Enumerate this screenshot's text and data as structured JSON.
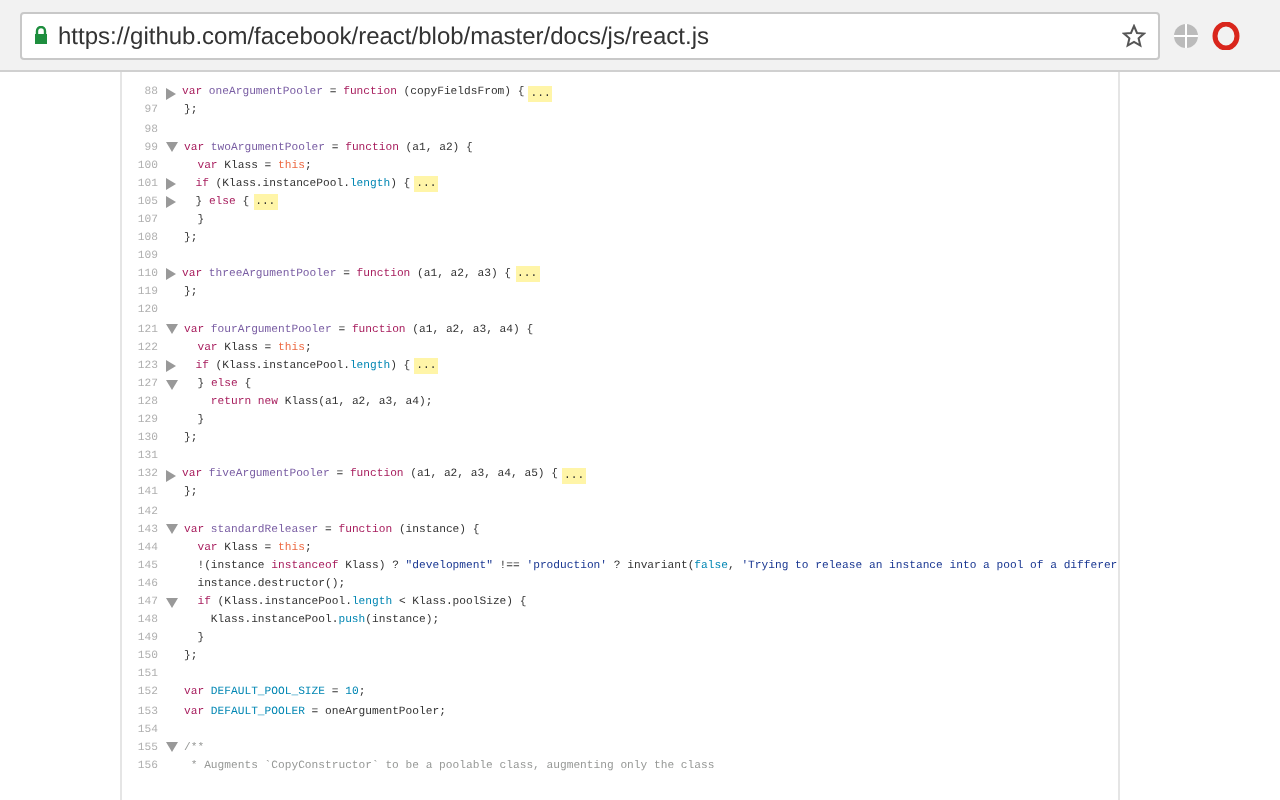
{
  "address_bar": {
    "url": "https://github.com/facebook/react/blob/master/docs/js/react.js"
  },
  "code_lines": [
    {
      "number": "88",
      "kind": "collapsed",
      "tokens": [
        {
          "kind": "kw",
          "text": "var"
        },
        {
          "kind": "name",
          "text": " oneArgumentPooler"
        },
        {
          "kind": "plain",
          "text": " = "
        },
        {
          "kind": "kw",
          "text": "function"
        },
        {
          "kind": "plain",
          "text": " (copyFieldsFrom) {"
        }
      ],
      "collapsed_marker": "..."
    },
    {
      "number": "97",
      "kind": "plain",
      "tokens": [
        {
          "kind": "plain",
          "text": "};"
        }
      ]
    },
    {
      "number": "98",
      "kind": "plain"
    },
    {
      "number": "99",
      "kind": "expanded",
      "tokens": [
        {
          "kind": "kw",
          "text": "var"
        },
        {
          "kind": "name",
          "text": " twoArgumentPooler"
        },
        {
          "kind": "plain",
          "text": " = "
        },
        {
          "kind": "kw",
          "text": "function"
        },
        {
          "kind": "plain",
          "text": " (a1, a2) {"
        }
      ]
    },
    {
      "number": "100",
      "kind": "plain",
      "tokens": [
        {
          "kind": "kw",
          "text": "  var"
        },
        {
          "kind": "plain",
          "text": " Klass = "
        },
        {
          "kind": "self",
          "text": "this"
        },
        {
          "kind": "plain",
          "text": ";"
        }
      ]
    },
    {
      "number": "101",
      "kind": "collapsed",
      "tokens": [
        {
          "kind": "kw",
          "text": "  if"
        },
        {
          "kind": "plain",
          "text": " (Klass.instancePool."
        },
        {
          "kind": "builtin",
          "text": "length"
        },
        {
          "kind": "plain",
          "text": ") {"
        }
      ],
      "collapsed_marker": "..."
    },
    {
      "number": "105",
      "kind": "collapsed",
      "tokens": [
        {
          "kind": "plain",
          "text": "  } "
        },
        {
          "kind": "kw",
          "text": "else"
        },
        {
          "kind": "plain",
          "text": " {"
        }
      ],
      "collapsed_marker": "..."
    },
    {
      "number": "107",
      "kind": "plain",
      "tokens": [
        {
          "kind": "plain",
          "text": "  }"
        }
      ]
    },
    {
      "number": "108",
      "kind": "plain",
      "tokens": [
        {
          "kind": "plain",
          "text": "};"
        }
      ]
    },
    {
      "number": "109",
      "kind": "plain"
    },
    {
      "number": "110",
      "kind": "collapsed",
      "tokens": [
        {
          "kind": "kw",
          "text": "var"
        },
        {
          "kind": "name",
          "text": " threeArgumentPooler"
        },
        {
          "kind": "plain",
          "text": " = "
        },
        {
          "kind": "kw",
          "text": "function"
        },
        {
          "kind": "plain",
          "text": " (a1, a2, a3) {"
        }
      ],
      "collapsed_marker": "..."
    },
    {
      "number": "119",
      "kind": "plain",
      "tokens": [
        {
          "kind": "plain",
          "text": "};"
        }
      ]
    },
    {
      "number": "120",
      "kind": "plain"
    },
    {
      "number": "121",
      "kind": "expanded",
      "tokens": [
        {
          "kind": "kw",
          "text": "var"
        },
        {
          "kind": "name",
          "text": " fourArgumentPooler"
        },
        {
          "kind": "plain",
          "text": " = "
        },
        {
          "kind": "kw",
          "text": "function"
        },
        {
          "kind": "plain",
          "text": " (a1, a2, a3, a4) {"
        }
      ]
    },
    {
      "number": "122",
      "kind": "plain",
      "tokens": [
        {
          "kind": "kw",
          "text": "  var"
        },
        {
          "kind": "plain",
          "text": " Klass = "
        },
        {
          "kind": "self",
          "text": "this"
        },
        {
          "kind": "plain",
          "text": ";"
        }
      ]
    },
    {
      "number": "123",
      "kind": "collapsed",
      "tokens": [
        {
          "kind": "kw",
          "text": "  if"
        },
        {
          "kind": "plain",
          "text": " (Klass.instancePool."
        },
        {
          "kind": "builtin",
          "text": "length"
        },
        {
          "kind": "plain",
          "text": ") {"
        }
      ],
      "collapsed_marker": "..."
    },
    {
      "number": "127",
      "kind": "expanded",
      "tokens": [
        {
          "kind": "plain",
          "text": "  } "
        },
        {
          "kind": "kw",
          "text": "else"
        },
        {
          "kind": "plain",
          "text": " {"
        }
      ]
    },
    {
      "number": "128",
      "kind": "plain",
      "tokens": [
        {
          "kind": "kw",
          "text": "    return"
        },
        {
          "kind": "kw",
          "text": " new"
        },
        {
          "kind": "plain",
          "text": " Klass(a1, a2, a3, a4);"
        }
      ]
    },
    {
      "number": "129",
      "kind": "plain",
      "tokens": [
        {
          "kind": "plain",
          "text": "  }"
        }
      ]
    },
    {
      "number": "130",
      "kind": "plain",
      "tokens": [
        {
          "kind": "plain",
          "text": "};"
        }
      ]
    },
    {
      "number": "131",
      "kind": "plain"
    },
    {
      "number": "132",
      "kind": "collapsed",
      "tokens": [
        {
          "kind": "kw",
          "text": "var"
        },
        {
          "kind": "name",
          "text": " fiveArgumentPooler"
        },
        {
          "kind": "plain",
          "text": " = "
        },
        {
          "kind": "kw",
          "text": "function"
        },
        {
          "kind": "plain",
          "text": " (a1, a2, a3, a4, a5) {"
        }
      ],
      "collapsed_marker": "..."
    },
    {
      "number": "141",
      "kind": "plain",
      "tokens": [
        {
          "kind": "plain",
          "text": "};"
        }
      ]
    },
    {
      "number": "142",
      "kind": "plain"
    },
    {
      "number": "143",
      "kind": "expanded",
      "tokens": [
        {
          "kind": "kw",
          "text": "var"
        },
        {
          "kind": "name",
          "text": " standardReleaser"
        },
        {
          "kind": "plain",
          "text": " = "
        },
        {
          "kind": "kw",
          "text": "function"
        },
        {
          "kind": "plain",
          "text": " (instance) {"
        }
      ]
    },
    {
      "number": "144",
      "kind": "plain",
      "tokens": [
        {
          "kind": "kw",
          "text": "  var"
        },
        {
          "kind": "plain",
          "text": " Klass = "
        },
        {
          "kind": "self",
          "text": "this"
        },
        {
          "kind": "plain",
          "text": ";"
        }
      ]
    },
    {
      "number": "145",
      "kind": "plain",
      "tokens": [
        {
          "kind": "plain",
          "text": "  !(instance "
        },
        {
          "kind": "kw",
          "text": "instanceof"
        },
        {
          "kind": "plain",
          "text": " Klass) ? "
        },
        {
          "kind": "str",
          "text": "\"development\""
        },
        {
          "kind": "plain",
          "text": " !== "
        },
        {
          "kind": "str",
          "text": "'production'"
        },
        {
          "kind": "plain",
          "text": " ? invariant("
        },
        {
          "kind": "builtin",
          "text": "false"
        },
        {
          "kind": "plain",
          "text": ", "
        },
        {
          "kind": "str",
          "text": "'Trying to release an instance into a pool of a differer"
        }
      ]
    },
    {
      "number": "146",
      "kind": "plain",
      "tokens": [
        {
          "kind": "plain",
          "text": "  instance.destructor();"
        }
      ]
    },
    {
      "number": "147",
      "kind": "expanded",
      "tokens": [
        {
          "kind": "kw",
          "text": "  if"
        },
        {
          "kind": "plain",
          "text": " (Klass.instancePool."
        },
        {
          "kind": "builtin",
          "text": "length"
        },
        {
          "kind": "plain",
          "text": " < Klass.poolSize) {"
        }
      ]
    },
    {
      "number": "148",
      "kind": "plain",
      "tokens": [
        {
          "kind": "plain",
          "text": "    Klass.instancePool."
        },
        {
          "kind": "builtin",
          "text": "push"
        },
        {
          "kind": "plain",
          "text": "(instance);"
        }
      ]
    },
    {
      "number": "149",
      "kind": "plain",
      "tokens": [
        {
          "kind": "plain",
          "text": "  }"
        }
      ]
    },
    {
      "number": "150",
      "kind": "plain",
      "tokens": [
        {
          "kind": "plain",
          "text": "};"
        }
      ]
    },
    {
      "number": "151",
      "kind": "plain"
    },
    {
      "number": "152",
      "kind": "plain",
      "tokens": [
        {
          "kind": "kw",
          "text": "var"
        },
        {
          "kind": "builtin",
          "text": " DEFAULT_POOL_SIZE"
        },
        {
          "kind": "plain",
          "text": " = "
        },
        {
          "kind": "builtin",
          "text": "10"
        },
        {
          "kind": "plain",
          "text": ";"
        }
      ]
    },
    {
      "number": "153",
      "kind": "plain",
      "tokens": [
        {
          "kind": "kw",
          "text": "var"
        },
        {
          "kind": "builtin",
          "text": " DEFAULT_POOLER"
        },
        {
          "kind": "plain",
          "text": " = oneArgumentPooler;"
        }
      ]
    },
    {
      "number": "154",
      "kind": "plain"
    },
    {
      "number": "155",
      "kind": "expanded",
      "tokens": [
        {
          "kind": "comment",
          "text": "/**"
        }
      ]
    },
    {
      "number": "156",
      "kind": "plain",
      "tokens": [
        {
          "kind": "comment",
          "text": " * Augments `CopyConstructor` to be a poolable class, augmenting only the class"
        }
      ]
    }
  ]
}
